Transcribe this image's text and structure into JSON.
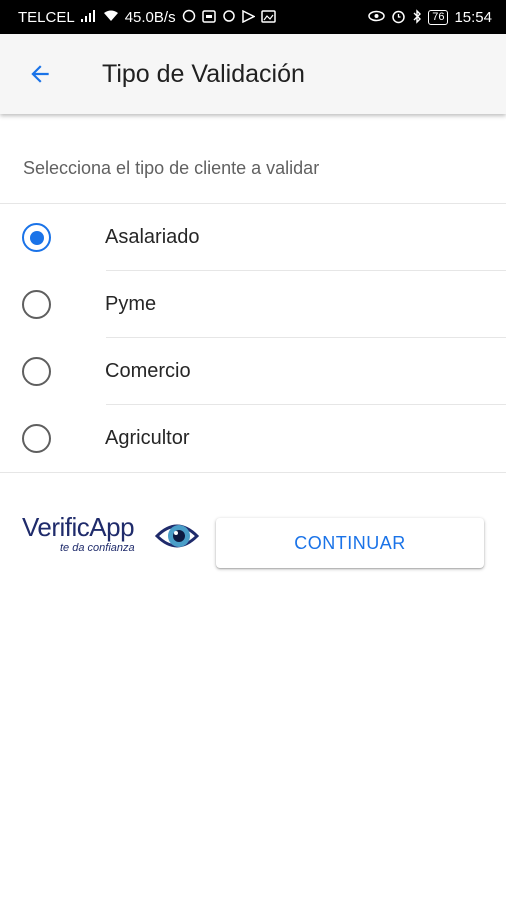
{
  "status_bar": {
    "carrier": "TELCEL",
    "net_speed": "45.0B/s",
    "battery": "76",
    "time": "15:54",
    "icons": [
      "signal-icon",
      "wifi-icon",
      "whatsapp-icon",
      "notification-icon",
      "sync-icon",
      "play-store-icon",
      "gallery-icon",
      "eye-icon",
      "alarm-icon",
      "bluetooth-icon",
      "battery-icon"
    ]
  },
  "app_bar": {
    "back_icon": "arrow-back-icon",
    "title": "Tipo de Validación"
  },
  "form": {
    "subtitle": "Selecciona el tipo de cliente a validar",
    "options": [
      {
        "label": "Asalariado",
        "selected": true
      },
      {
        "label": "Pyme",
        "selected": false
      },
      {
        "label": "Comercio",
        "selected": false
      },
      {
        "label": "Agricultor",
        "selected": false
      }
    ]
  },
  "footer": {
    "logo_text": "VerificApp",
    "logo_tagline": "te da confianza",
    "continue_label": "CONTINUAR"
  },
  "colors": {
    "accent": "#1a73e8",
    "logo": "#1f2b6b",
    "status_bar": "#000000"
  }
}
